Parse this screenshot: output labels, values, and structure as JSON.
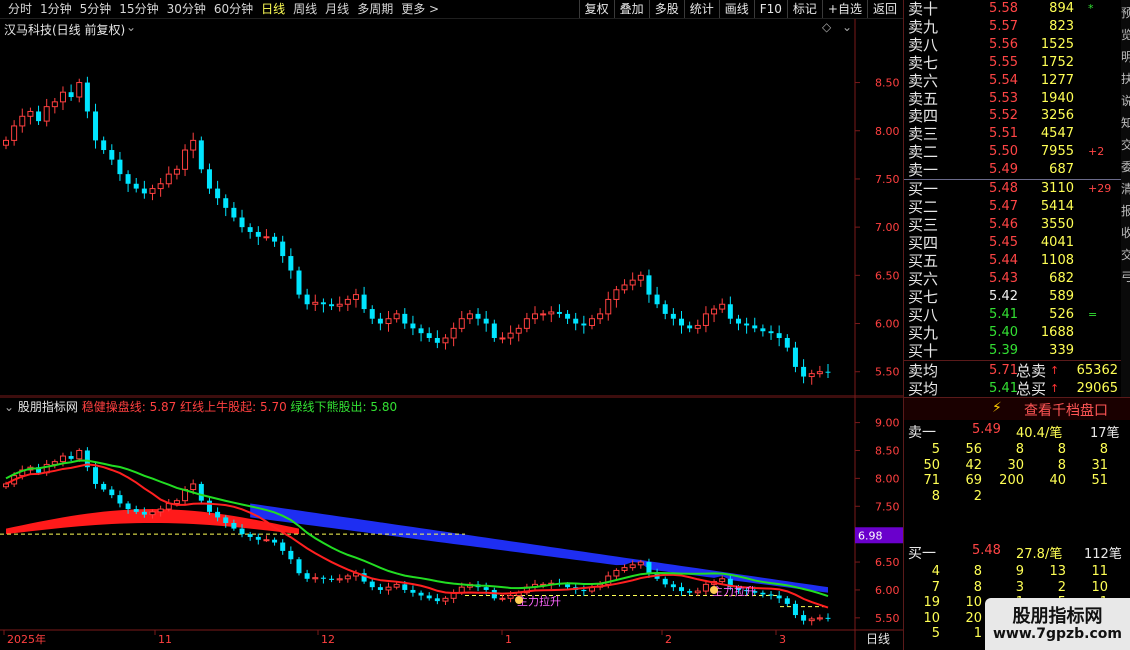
{
  "toolbar": {
    "periods": [
      "分时",
      "1分钟",
      "5分钟",
      "15分钟",
      "30分钟",
      "60分钟",
      "日线",
      "周线",
      "月线",
      "多周期",
      "更多 >"
    ],
    "active_period": "日线",
    "actions": [
      "复权",
      "叠加",
      "多股",
      "统计",
      "画线",
      "F10",
      "标记",
      "+自选",
      "返回"
    ]
  },
  "main_chart": {
    "title": "汉马科技(日线 前复权)",
    "y_ticks": [
      "8.50",
      "8.00",
      "7.50",
      "7.00",
      "6.50",
      "6.00",
      "5.50"
    ]
  },
  "indicator": {
    "name": "股朋指标网",
    "line1": "稳健操盘线: 5.87",
    "line2": "红线上牛股起: 5.70",
    "line3": "绿线下熊股出: 5.80",
    "y_ticks": [
      "9.00",
      "8.50",
      "8.00",
      "7.50",
      "7.00",
      "6.50",
      "6.00",
      "5.50"
    ],
    "price_tag": "6.98",
    "ann1": "主力拉升",
    "ann2": "主力拉升",
    "x_labels": [
      "2025年",
      "11",
      "12",
      "1",
      "2",
      "3"
    ],
    "period_label": "日线"
  },
  "orderbook": {
    "asks": [
      {
        "label": "卖十",
        "price": "5.58",
        "vol": "894",
        "chg": "*"
      },
      {
        "label": "卖九",
        "price": "5.57",
        "vol": "823",
        "chg": ""
      },
      {
        "label": "卖八",
        "price": "5.56",
        "vol": "1525",
        "chg": ""
      },
      {
        "label": "卖七",
        "price": "5.55",
        "vol": "1752",
        "chg": ""
      },
      {
        "label": "卖六",
        "price": "5.54",
        "vol": "1277",
        "chg": ""
      },
      {
        "label": "卖五",
        "price": "5.53",
        "vol": "1940",
        "chg": ""
      },
      {
        "label": "卖四",
        "price": "5.52",
        "vol": "3256",
        "chg": ""
      },
      {
        "label": "卖三",
        "price": "5.51",
        "vol": "4547",
        "chg": ""
      },
      {
        "label": "卖二",
        "price": "5.50",
        "vol": "7955",
        "chg": "+2"
      },
      {
        "label": "卖一",
        "price": "5.49",
        "vol": "687",
        "chg": ""
      }
    ],
    "bids": [
      {
        "label": "买一",
        "price": "5.48",
        "vol": "3110",
        "chg": "+29",
        "color": "red"
      },
      {
        "label": "买二",
        "price": "5.47",
        "vol": "5414",
        "chg": "",
        "color": "red"
      },
      {
        "label": "买三",
        "price": "5.46",
        "vol": "3550",
        "chg": "",
        "color": "red"
      },
      {
        "label": "买四",
        "price": "5.45",
        "vol": "4041",
        "chg": "",
        "color": "red"
      },
      {
        "label": "买五",
        "price": "5.44",
        "vol": "1108",
        "chg": "",
        "color": "red"
      },
      {
        "label": "买六",
        "price": "5.43",
        "vol": "682",
        "chg": "",
        "color": "red"
      },
      {
        "label": "买七",
        "price": "5.42",
        "vol": "589",
        "chg": "",
        "color": "white"
      },
      {
        "label": "买八",
        "price": "5.41",
        "vol": "526",
        "chg": "=",
        "color": "green"
      },
      {
        "label": "买九",
        "price": "5.40",
        "vol": "1688",
        "chg": "",
        "color": "green"
      },
      {
        "label": "买十",
        "price": "5.39",
        "vol": "339",
        "chg": "",
        "color": "green"
      }
    ],
    "ask_avg_label": "卖均",
    "ask_avg": "5.71",
    "total_sell_label": "总卖",
    "total_sell": "65362",
    "bid_avg_label": "买均",
    "bid_avg": "5.41",
    "total_buy_label": "总买",
    "total_buy": "29065"
  },
  "side_strip_chars": "预览明扶说知交委清报收交弓",
  "tick_panel": {
    "title": "查看千档盘口",
    "sell1_label": "卖一",
    "sell1_price": "5.49",
    "sell1_avg": "40.4/笔",
    "sell1_count": "17笔",
    "sell_grid": [
      "5",
      "56",
      "8",
      "8",
      "8",
      "50",
      "42",
      "30",
      "8",
      "31",
      "71",
      "69",
      "200",
      "40",
      "51",
      "8",
      "2",
      "",
      "",
      ""
    ],
    "buy1_label": "买一",
    "buy1_price": "5.48",
    "buy1_avg": "27.8/笔",
    "buy1_count": "112笔",
    "buy_grid": [
      "4",
      "8",
      "9",
      "13",
      "11",
      "7",
      "8",
      "3",
      "2",
      "10",
      "19",
      "10",
      "1",
      "5",
      "1",
      "10",
      "20",
      "",
      "",
      "",
      "5",
      "1",
      "",
      "",
      ""
    ]
  },
  "watermark": {
    "line1": "股朋指标网",
    "line2": "www.7gpzb.com"
  }
}
